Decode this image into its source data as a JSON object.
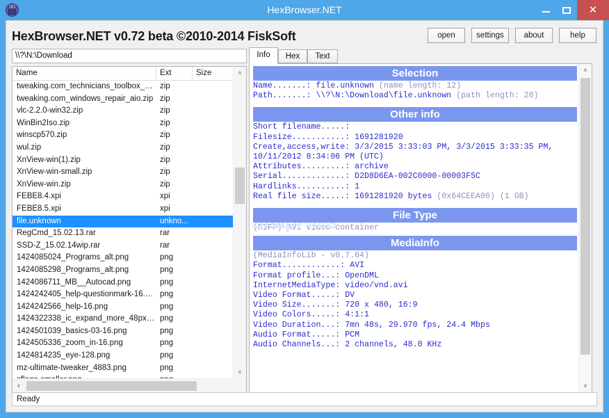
{
  "window": {
    "title": "HexBrowser.NET",
    "icon": "app-icon",
    "icon_digits": "101",
    "minimize_label": "–",
    "maximize_label": "☐",
    "close_label": "✕",
    "titlebar_color": "#4fa6e8",
    "close_color": "#c75050"
  },
  "header": {
    "product_line": "HexBrowser.NET v0.72 beta  ©2010-2014 FiskSoft"
  },
  "toolbar": {
    "buttons": [
      {
        "label": "open",
        "name": "open-button"
      },
      {
        "label": "settings",
        "name": "settings-button"
      },
      {
        "label": "about",
        "name": "about-button"
      },
      {
        "label": "help",
        "name": "help-button"
      }
    ]
  },
  "path_input": {
    "value": "\\\\?\\N:\\Download",
    "placeholder": "path"
  },
  "tabs": {
    "items": [
      {
        "label": "Info",
        "active": true
      },
      {
        "label": "Hex",
        "active": false
      },
      {
        "label": "Text",
        "active": false
      }
    ]
  },
  "file_list": {
    "columns": [
      "Name",
      "Ext",
      "Size"
    ],
    "rows": [
      {
        "name": "tweaking.com_technicians_toolbox_port...",
        "ext": "zip",
        "size": "",
        "selected": false
      },
      {
        "name": "tweaking.com_windows_repair_aio.zip",
        "ext": "zip",
        "size": "",
        "selected": false
      },
      {
        "name": "vlc-2.2.0-win32.zip",
        "ext": "zip",
        "size": "",
        "selected": false
      },
      {
        "name": "WinBin2Iso.zip",
        "ext": "zip",
        "size": "",
        "selected": false
      },
      {
        "name": "winscp570.zip",
        "ext": "zip",
        "size": "",
        "selected": false
      },
      {
        "name": "wul.zip",
        "ext": "zip",
        "size": "",
        "selected": false
      },
      {
        "name": "XnView-win(1).zip",
        "ext": "zip",
        "size": "",
        "selected": false
      },
      {
        "name": "XnView-win-small.zip",
        "ext": "zip",
        "size": "",
        "selected": false
      },
      {
        "name": "XnView-win.zip",
        "ext": "zip",
        "size": "",
        "selected": false
      },
      {
        "name": "FEBE8.4.xpi",
        "ext": "xpi",
        "size": "",
        "selected": false
      },
      {
        "name": "FEBE8.5.xpi",
        "ext": "xpi",
        "size": "",
        "selected": false
      },
      {
        "name": "file.unknown",
        "ext": "unkno...",
        "size": "",
        "selected": true
      },
      {
        "name": "RegCmd_15.02.13.rar",
        "ext": "rar",
        "size": "",
        "selected": false
      },
      {
        "name": "SSD-Z_15.02.14wip.rar",
        "ext": "rar",
        "size": "",
        "selected": false
      },
      {
        "name": "1424085024_Programs_alt.png",
        "ext": "png",
        "size": "",
        "selected": false
      },
      {
        "name": "1424085298_Programs_alt.png",
        "ext": "png",
        "size": "",
        "selected": false
      },
      {
        "name": "1424086711_MB__Autocad.png",
        "ext": "png",
        "size": "",
        "selected": false
      },
      {
        "name": "1424242405_help-questionmark-16.png",
        "ext": "png",
        "size": "",
        "selected": false
      },
      {
        "name": "1424242566_help-16.png",
        "ext": "png",
        "size": "",
        "selected": false
      },
      {
        "name": "1424322338_ic_expand_more_48px-16....",
        "ext": "png",
        "size": "",
        "selected": false
      },
      {
        "name": "1424501039_basics-03-16.png",
        "ext": "png",
        "size": "",
        "selected": false
      },
      {
        "name": "1424505336_zoom_in-16.png",
        "ext": "png",
        "size": "",
        "selected": false
      },
      {
        "name": "1424814235_eye-128.png",
        "ext": "png",
        "size": "",
        "selected": false
      },
      {
        "name": "mz-ultimate-tweaker_4883.png",
        "ext": "png",
        "size": "",
        "selected": false
      },
      {
        "name": "sflogo-smaller.png",
        "ext": "png",
        "size": "",
        "selected": false
      }
    ],
    "scroll_up_icon": "˄",
    "scroll_down_icon": "˅",
    "scroll_left_icon": "‹",
    "scroll_right_icon": "›"
  },
  "info": {
    "watermark": "SnapFiles",
    "sections": [
      {
        "title": "Selection",
        "lines": [
          {
            "label": "Name.......: ",
            "value": "file.unknown",
            "note": " (name length: 12)"
          },
          {
            "label": "Path.......: ",
            "value": "\\\\?\\N:\\Download\\file.unknown",
            "note": " (path length: 28)"
          }
        ]
      },
      {
        "title": "Other info",
        "lines": [
          {
            "label": "Short filename.....: ",
            "value": "",
            "note": ""
          },
          {
            "label": "Filesize...........: ",
            "value": "1691281920",
            "note": ""
          },
          {
            "label": "Create,access,write: ",
            "value": "3/3/2015 3:33:03 PM, 3/3/2015 3:33:35 PM,",
            "note": ""
          },
          {
            "label": "",
            "value": "10/11/2012 8:34:06 PM (UTC)",
            "note": ""
          },
          {
            "label": "Attributes.........: ",
            "value": "archive",
            "note": ""
          },
          {
            "label": "Serial.............: ",
            "value": "D2D8D6EA-002C0000-00003F5C",
            "note": ""
          },
          {
            "label": "Hardlinks..........: ",
            "value": "1",
            "note": ""
          },
          {
            "label": "Real file size.....: ",
            "value": "1691281920 bytes",
            "note": " (0x64CEEA00) (1 GB)"
          }
        ]
      },
      {
        "title": "File Type",
        "lines": [
          {
            "label": "",
            "value": "",
            "note": "(RIFF) AVI video container"
          }
        ]
      },
      {
        "title": "MediaInfo",
        "lines": [
          {
            "label": "",
            "value": "",
            "note": "(MediaInfoLib - v0.7.64)"
          },
          {
            "label": "Format............: ",
            "value": "AVI",
            "note": ""
          },
          {
            "label": "Format profile...: ",
            "value": "OpenDML",
            "note": ""
          },
          {
            "label": "InternetMediaType: ",
            "value": "video/vnd.avi",
            "note": ""
          },
          {
            "label": "Video Format.....: ",
            "value": "DV",
            "note": ""
          },
          {
            "label": "Video Size.......: ",
            "value": "720 x 480, 16:9",
            "note": ""
          },
          {
            "label": "Video Colors.....: ",
            "value": "4:1:1",
            "note": ""
          },
          {
            "label": "Video Duration...: ",
            "value": "7mn 48s, 29.970 fps, 24.4 Mbps",
            "note": ""
          },
          {
            "label": "Audio Format.....: ",
            "value": "PCM",
            "note": ""
          },
          {
            "label": "Audio Channels...: ",
            "value": "2 channels, 48.0 KHz",
            "note": ""
          }
        ]
      }
    ],
    "scroll_up_icon": "˄",
    "scroll_down_icon": "˅"
  },
  "status": {
    "text": "Ready"
  },
  "colors": {
    "titlebar": "#4fa6e8",
    "close_button": "#c75050",
    "selection": "#1e90ff",
    "section_header": "#7b96ef",
    "mono_text": "#2b2bcf",
    "mono_dim": "#8f8fbf"
  }
}
